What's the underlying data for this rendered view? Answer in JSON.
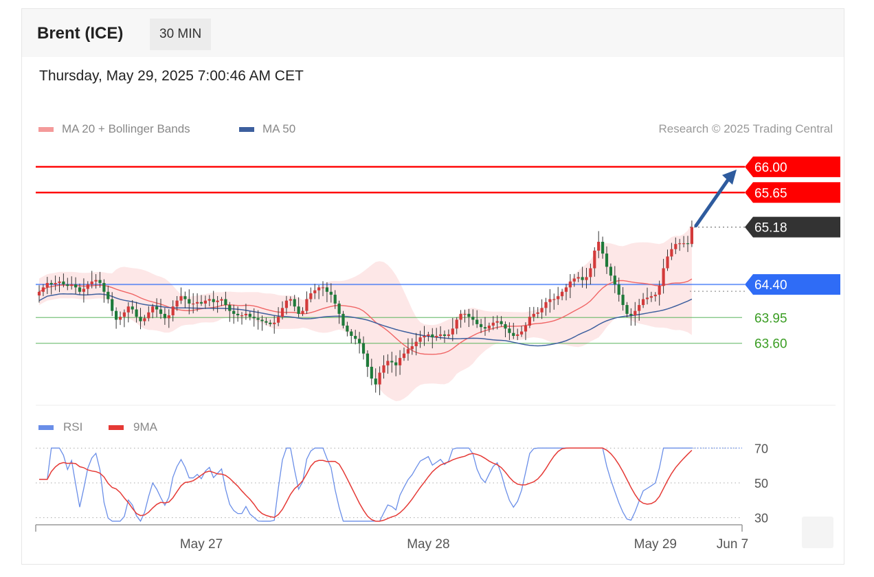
{
  "header": {
    "instrument": "Brent (ICE)",
    "timeframe": "30 MIN",
    "datetime": "Thursday, May 29, 2025 7:00:46 AM CET"
  },
  "legend": {
    "ma20_label": "MA 20 + Bollinger Bands",
    "ma50_label": "MA 50",
    "research": "Research © 2025 Trading Central"
  },
  "rsi_legend": {
    "rsi_label": "RSI",
    "ma9_label": "9MA"
  },
  "colors": {
    "resistance": "#ff0000",
    "last_price": "#333333",
    "pivot": "#2f6cf6",
    "support": "#4caf50",
    "support_text": "#3a9d23",
    "bull_candle": "#d33a3a",
    "bear_candle": "#1f7a3a",
    "ma20": "#f06565",
    "ma50": "#3d5f9e",
    "band_fill": "#fde3e3",
    "rsi": "#6a8ee8",
    "rsi_ma": "#e53935",
    "arrow": "#2e5b9e"
  },
  "chart_data": [
    {
      "type": "candlestick",
      "ylim": [
        62.85,
        66.4
      ],
      "levels": [
        {
          "label": "66.00",
          "value": 66.0,
          "kind": "resistance"
        },
        {
          "label": "65.65",
          "value": 65.65,
          "kind": "resistance"
        },
        {
          "label": "65.18",
          "value": 65.18,
          "kind": "last"
        },
        {
          "label": "64.40",
          "value": 64.4,
          "kind": "pivot"
        },
        {
          "label": "63.95",
          "value": 63.95,
          "kind": "support"
        },
        {
          "label": "63.60",
          "value": 63.6,
          "kind": "support"
        }
      ],
      "x_ticks": [
        {
          "label": "May 27",
          "index": 40
        },
        {
          "label": "May 28",
          "index": 96
        },
        {
          "label": "May 29",
          "index": 152
        },
        {
          "label": "Jun 7",
          "index": 176
        }
      ],
      "bar_count": 162,
      "arrow_target": 66.0,
      "close": [
        64.3,
        64.36,
        64.42,
        64.4,
        64.42,
        64.44,
        64.4,
        64.38,
        64.4,
        64.36,
        64.3,
        64.34,
        64.4,
        64.44,
        64.46,
        64.42,
        64.3,
        64.2,
        64.04,
        63.92,
        63.96,
        64.02,
        64.1,
        64.06,
        63.96,
        63.9,
        63.94,
        64.02,
        64.1,
        64.06,
        64.0,
        63.94,
        63.98,
        64.1,
        64.18,
        64.24,
        64.2,
        64.14,
        64.14,
        64.16,
        64.14,
        64.18,
        64.2,
        64.16,
        64.18,
        64.2,
        64.12,
        64.04,
        64.0,
        63.98,
        63.98,
        64.0,
        63.96,
        63.94,
        63.92,
        63.9,
        63.88,
        63.86,
        63.88,
        63.96,
        64.08,
        64.18,
        64.2,
        64.1,
        64.0,
        64.04,
        64.2,
        64.28,
        64.32,
        64.36,
        64.36,
        64.3,
        64.26,
        64.14,
        64.0,
        63.84,
        63.76,
        63.7,
        63.66,
        63.6,
        63.46,
        63.28,
        63.12,
        63.04,
        63.2,
        63.3,
        63.36,
        63.34,
        63.3,
        63.4,
        63.46,
        63.52,
        63.56,
        63.62,
        63.68,
        63.7,
        63.72,
        63.68,
        63.7,
        63.72,
        63.7,
        63.72,
        63.8,
        63.92,
        64.0,
        64.0,
        63.96,
        63.92,
        63.86,
        63.82,
        63.8,
        63.84,
        63.88,
        63.9,
        63.86,
        63.8,
        63.74,
        63.7,
        63.72,
        63.76,
        63.84,
        63.96,
        64.0,
        64.02,
        64.08,
        64.16,
        64.2,
        64.2,
        64.24,
        64.3,
        64.36,
        64.44,
        64.48,
        64.5,
        64.46,
        64.5,
        64.62,
        64.86,
        64.98,
        64.82,
        64.64,
        64.52,
        64.4,
        64.26,
        64.12,
        64.0,
        63.98,
        64.04,
        64.12,
        64.2,
        64.22,
        64.24,
        64.26,
        64.38,
        64.62,
        64.78,
        64.88,
        64.95,
        64.96,
        64.96,
        64.95,
        65.18
      ]
    },
    {
      "type": "line",
      "ylim": [
        20,
        80
      ],
      "y_ticks": [
        70,
        50,
        30
      ],
      "series": [
        {
          "name": "RSI"
        },
        {
          "name": "9MA"
        }
      ]
    }
  ]
}
